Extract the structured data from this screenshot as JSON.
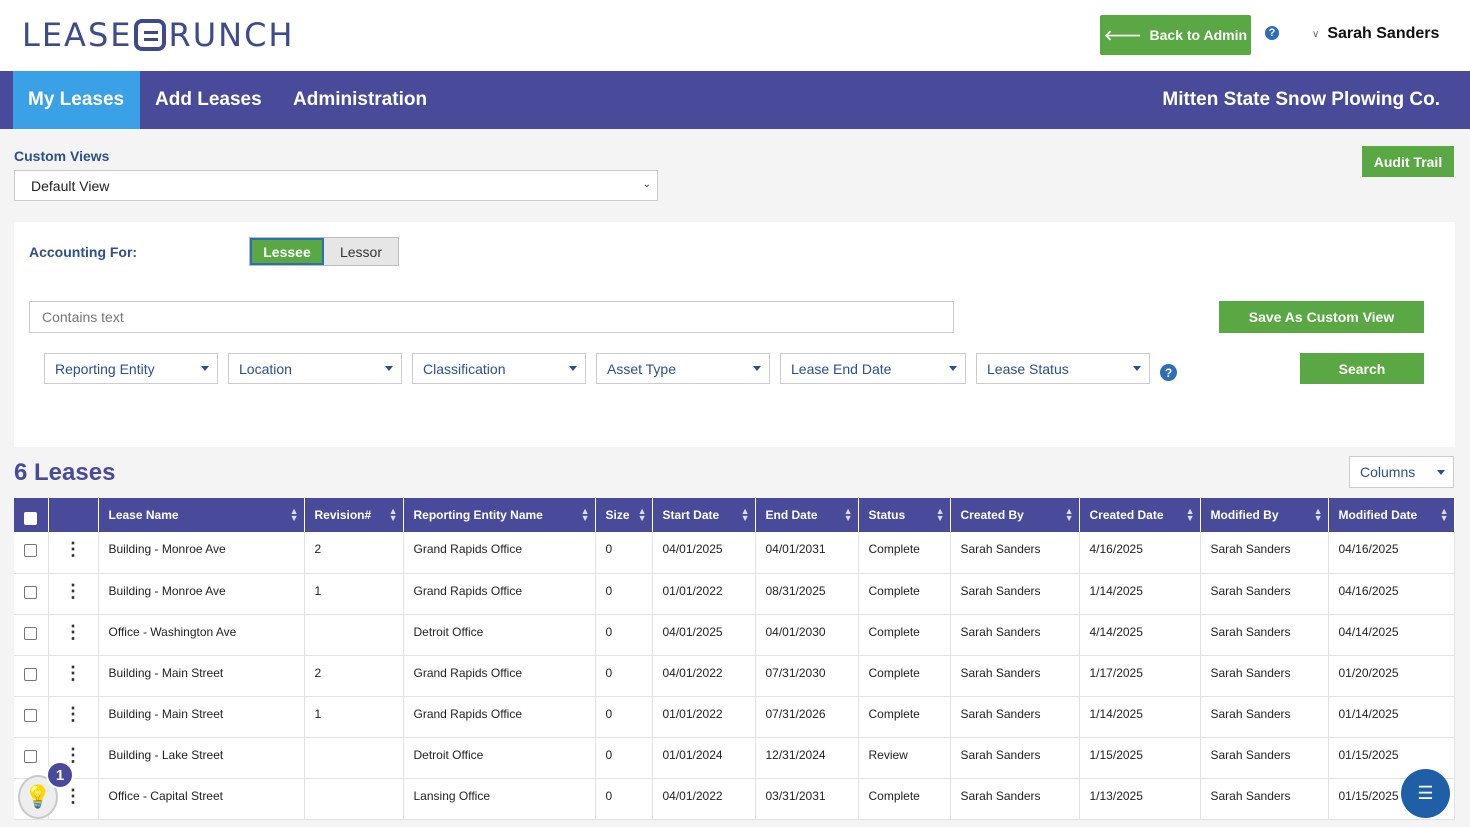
{
  "header": {
    "logo_left": "LEASE",
    "logo_right": "RUNCH",
    "back_label": "Back to Admin",
    "help_glyph": "?",
    "user_name": "Sarah Sanders"
  },
  "nav": {
    "tabs": [
      {
        "label": "My Leases",
        "active": true
      },
      {
        "label": "Add Leases",
        "active": false
      },
      {
        "label": "Administration",
        "active": false
      }
    ],
    "company": "Mitten State Snow Plowing Co."
  },
  "custom_views": {
    "label": "Custom Views",
    "selected": "Default View"
  },
  "audit_label": "Audit Trail",
  "filters": {
    "accounting_label": "Accounting For:",
    "toggle_on": "Lessee",
    "toggle_off": "Lessor",
    "search_placeholder": "Contains text",
    "save_view_label": "Save As Custom View",
    "dropdowns": [
      "Reporting Entity",
      "Location",
      "Classification",
      "Asset Type",
      "Lease End Date",
      "Lease Status"
    ],
    "search_label": "Search"
  },
  "leases": {
    "count_label": "6 Leases",
    "columns_label": "Columns",
    "headers": [
      "Lease Name",
      "Revision#",
      "Reporting Entity Name",
      "Size",
      "Start Date",
      "End Date",
      "Status",
      "Created By",
      "Created Date",
      "Modified By",
      "Modified Date"
    ],
    "rows": [
      [
        "Building - Monroe Ave",
        "2",
        "Grand Rapids Office",
        "0",
        "04/01/2025",
        "04/01/2031",
        "Complete",
        "Sarah Sanders",
        "4/16/2025",
        "Sarah Sanders",
        "04/16/2025"
      ],
      [
        "Building - Monroe Ave",
        "1",
        "Grand Rapids Office",
        "0",
        "01/01/2022",
        "08/31/2025",
        "Complete",
        "Sarah Sanders",
        "1/14/2025",
        "Sarah Sanders",
        "04/16/2025"
      ],
      [
        "Office - Washington Ave",
        "",
        "Detroit Office",
        "0",
        "04/01/2025",
        "04/01/2030",
        "Complete",
        "Sarah Sanders",
        "4/14/2025",
        "Sarah Sanders",
        "04/14/2025"
      ],
      [
        "Building - Main Street",
        "2",
        "Grand Rapids Office",
        "0",
        "04/01/2022",
        "07/31/2030",
        "Complete",
        "Sarah Sanders",
        "1/17/2025",
        "Sarah Sanders",
        "01/20/2025"
      ],
      [
        "Building - Main Street",
        "1",
        "Grand Rapids Office",
        "0",
        "01/01/2022",
        "07/31/2026",
        "Complete",
        "Sarah Sanders",
        "1/14/2025",
        "Sarah Sanders",
        "01/14/2025"
      ],
      [
        "Building - Lake Street",
        "",
        "Detroit Office",
        "0",
        "01/01/2024",
        "12/31/2024",
        "Review",
        "Sarah Sanders",
        "1/15/2025",
        "Sarah Sanders",
        "01/15/2025"
      ],
      [
        "Office - Capital Street",
        "",
        "Lansing Office",
        "0",
        "04/01/2022",
        "03/31/2031",
        "Complete",
        "Sarah Sanders",
        "1/13/2025",
        "Sarah Sanders",
        "01/15/2025"
      ]
    ]
  },
  "widgets": {
    "notification_count": "1"
  },
  "icons": {
    "back": "arrow-left-icon",
    "user": "chevron-down-icon",
    "menu": "hamburger-icon",
    "tips": "lightbulb-icon"
  },
  "colors": {
    "brand": "#4a4a9b",
    "active_tab": "#3aa1e6",
    "action_green": "#5aa843",
    "help_blue": "#2f6db5"
  }
}
